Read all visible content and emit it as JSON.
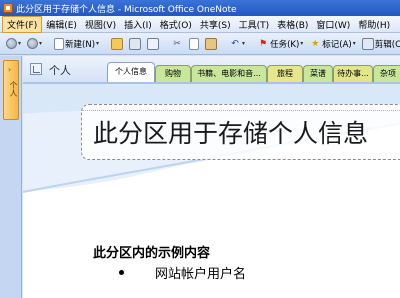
{
  "window": {
    "title": "此分区用于存储个人信息 - Microsoft Office OneNote"
  },
  "menu": [
    "文件(F)",
    "编辑(E)",
    "视图(V)",
    "插入(I)",
    "格式(O)",
    "共享(S)",
    "工具(T)",
    "表格(B)",
    "窗口(W)",
    "帮助(H)"
  ],
  "toolbar": {
    "new_label": "新建(N)",
    "tasks_label": "任务(K)",
    "tags_label": "标记(A)",
    "clip_label": "剪辑(C)"
  },
  "leftnav": {
    "notebook_label": "个人"
  },
  "notebook": {
    "name": "个人"
  },
  "tabs": [
    {
      "label": "个人信息",
      "color": "#ffffff",
      "selected": true
    },
    {
      "label": "购物",
      "color": "#c9e79a",
      "selected": false
    },
    {
      "label": "书籍、电影和音...",
      "color": "#c9e79a",
      "selected": false
    },
    {
      "label": "旅程",
      "color": "#e6e78c",
      "selected": false
    },
    {
      "label": "菜谱",
      "color": "#c9e79a",
      "selected": false
    },
    {
      "label": "待办事...",
      "color": "#e3e58a",
      "selected": false
    },
    {
      "label": "杂项",
      "color": "#c9e79a",
      "selected": false
    }
  ],
  "page": {
    "title": "此分区用于存储个人信息",
    "heading": "此分区内的示例内容",
    "bullets": [
      "网站帐户用户名"
    ]
  }
}
